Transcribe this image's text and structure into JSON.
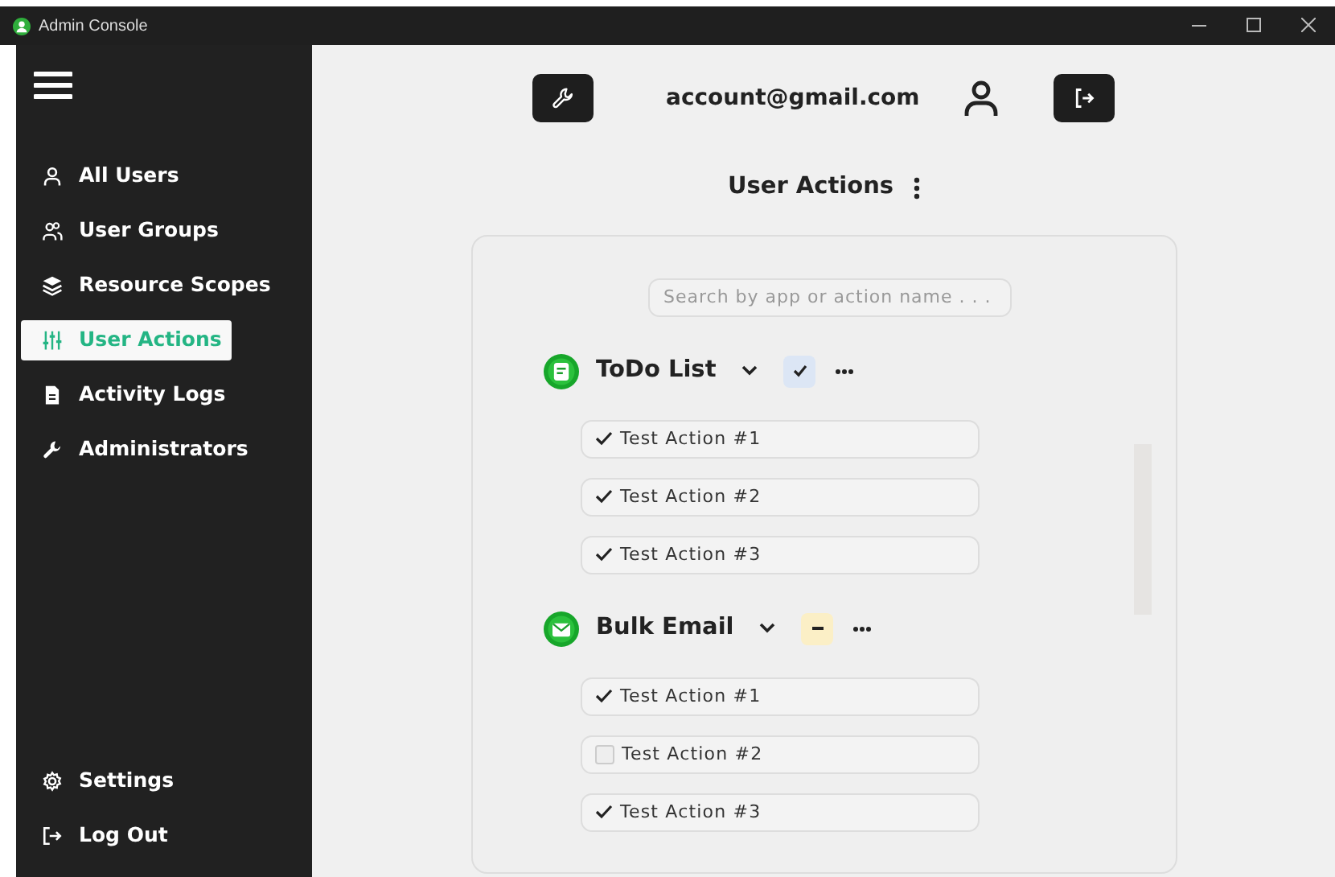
{
  "window": {
    "title": "Admin Console"
  },
  "sidebar": {
    "items": [
      {
        "label": "All Users",
        "selected": false
      },
      {
        "label": "User Groups",
        "selected": false
      },
      {
        "label": "Resource Scopes",
        "selected": false
      },
      {
        "label": "User Actions",
        "selected": true
      },
      {
        "label": "Activity Logs",
        "selected": false
      },
      {
        "label": "Administrators",
        "selected": false
      }
    ],
    "footer_items": [
      {
        "label": "Settings"
      },
      {
        "label": "Log Out"
      }
    ]
  },
  "header": {
    "account": "account@gmail.com"
  },
  "page_title": "User Actions",
  "search": {
    "placeholder": "Search by app or action name . . ."
  },
  "groups": [
    {
      "name": "ToDo List",
      "kind": "note",
      "expanded": true,
      "checked": true,
      "indeterminate": false,
      "actions": [
        {
          "label": "Test Action #1",
          "checked": true
        },
        {
          "label": "Test Action #2",
          "checked": true
        },
        {
          "label": "Test Action #3",
          "checked": true
        }
      ]
    },
    {
      "name": "Bulk Email",
      "kind": "mail",
      "expanded": true,
      "checked": true,
      "indeterminate": true,
      "actions": [
        {
          "label": "Test Action #1",
          "checked": true
        },
        {
          "label": "Test Action #2",
          "checked": false
        },
        {
          "label": "Test Action #3",
          "checked": true
        }
      ]
    }
  ]
}
